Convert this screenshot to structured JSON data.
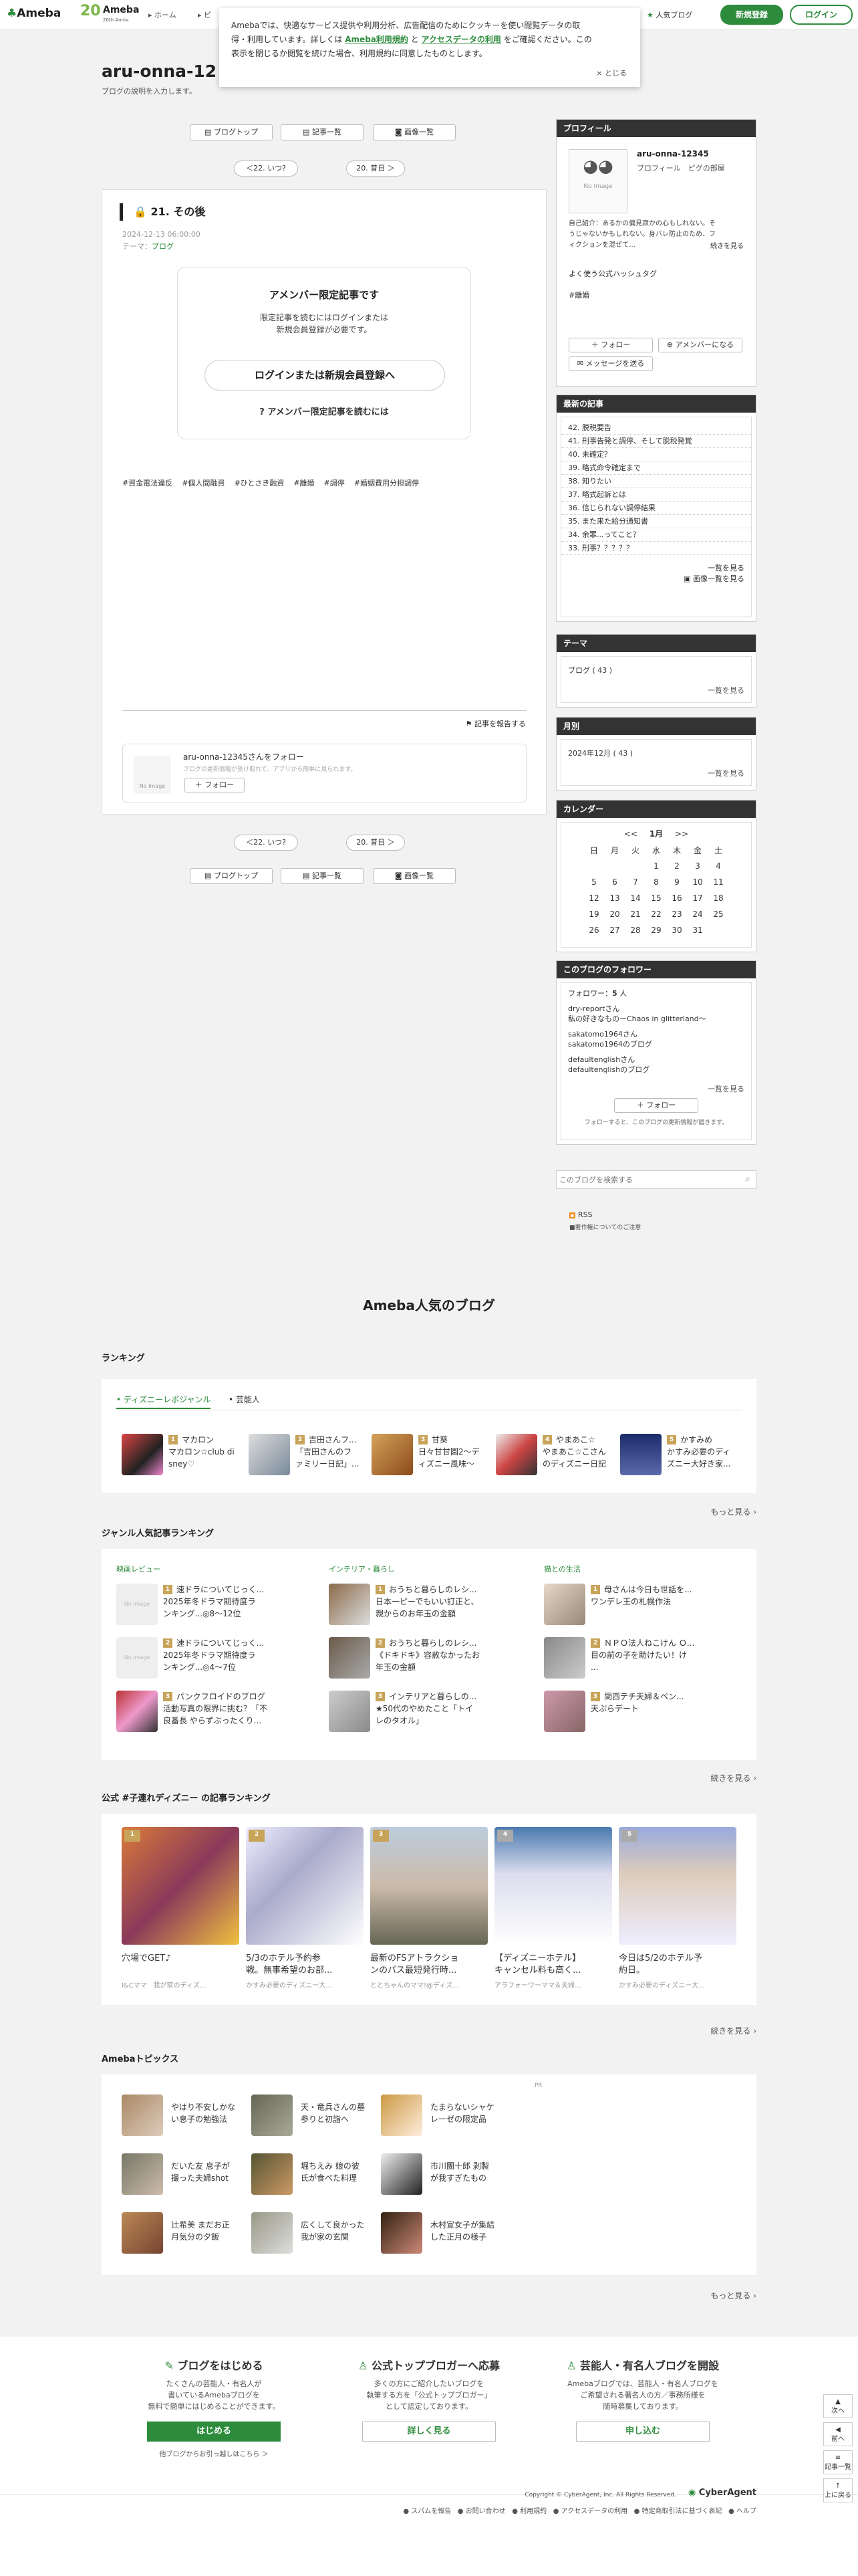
{
  "header": {
    "logo": "Ameba",
    "logo2": "Ameba",
    "logo2_sub": "20th Anniv.",
    "nav": [
      "ホーム",
      "ピ"
    ],
    "popular": "人気ブログ",
    "signup": "新規登録",
    "login": "ログイン"
  },
  "cookie": {
    "text1": "Amebaでは、快適なサービス提供や利用分析、広告配信のためにクッキーを使い閲覧データの取",
    "text2": "得・利用しています。詳しくは ",
    "terms": "Ameba利用規約",
    "mid": " と ",
    "access": "アクセスデータの利用",
    "text3": " をご確認ください。この",
    "text4": "表示を閉じるか閲覧を続けた場合、利用規約に同意したものとします。",
    "close": "× とじる"
  },
  "blog": {
    "title": "aru-onna-12",
    "desc": "ブログの説明を入力します。"
  },
  "nav_top": {
    "top": "ブログトップ",
    "list": "記事一覧",
    "images": "画像一覧",
    "prev": "＜22. いつ?",
    "next": "20. 昔日 ＞"
  },
  "article": {
    "title": "21. その後",
    "date": "2024-12-13 06:00:00",
    "theme": "テーマ：",
    "theme_link": "ブログ",
    "member_h": "アメンバー限定記事です",
    "member_p1": "限定記事を読むにはログインまたは",
    "member_p2": "新規会員登録が必要です。",
    "cta": "ログインまたは新規会員登録へ",
    "how": "アメンバー限定記事を読むには",
    "tags": [
      "#資金電法違反",
      "#個人間融資",
      "#ひとさき融資",
      "#離婚",
      "#調停",
      "#婚姻費用分担調停"
    ],
    "report": "記事を報告する",
    "follow_title": "aru-onna-12345さんをフォロー",
    "follow_desc": "ブログの更新情報が受け取れて、アプリから簡単に見られます。",
    "follow_btn": "フォロー"
  },
  "profile": {
    "title": "プロフィール",
    "name": "aru-onna-12345",
    "links": "プロフィール　ピグの部屋",
    "bio1": "自己紹介：あるかの偏見寂かの心もしれない。そ",
    "bio2": "うじゃないかもしれない。身バレ防止のため、フ",
    "bio3": "ィクションを混ぜて...",
    "bio_more": "続きを見る",
    "hashtag_h": "よく使う公式ハッシュタグ",
    "hashtag": "#離婚",
    "follow": "フォロー",
    "amember": "アメンバーになる",
    "message": "メッセージを送る",
    "noimage": "No Image"
  },
  "recent": {
    "title": "最新の記事",
    "items": [
      "42. 脱税要告",
      "41. 刑事告発と調停、そして脱税発覚",
      "40. 未確定？",
      "39. 略式命令確定まで",
      "38. 知りたい",
      "37. 略式起訴とは",
      "36. 信じられない調停結果",
      "35. また来た給分通知書",
      "34. 余罪...ってこと？",
      "33. 刑事？？？？？"
    ],
    "more": "一覧を見る",
    "img_more": "画像一覧を見る"
  },
  "theme": {
    "title": "テーマ",
    "item": "ブログ ( 43 )",
    "more": "一覧を見る"
  },
  "monthly": {
    "title": "月別",
    "item": "2024年12月 ( 43 )",
    "more": "一覧を見る"
  },
  "calendar": {
    "title": "カレンダー",
    "month": "1月",
    "prev": "<<",
    "next": ">>",
    "days": [
      "日",
      "月",
      "火",
      "水",
      "木",
      "金",
      "土"
    ],
    "weeks": [
      [
        "",
        "",
        "",
        "1",
        "2",
        "3",
        "4"
      ],
      [
        "5",
        "6",
        "7",
        "8",
        "9",
        "10",
        "11"
      ],
      [
        "12",
        "13",
        "14",
        "15",
        "16",
        "17",
        "18"
      ],
      [
        "19",
        "20",
        "21",
        "22",
        "23",
        "24",
        "25"
      ],
      [
        "26",
        "27",
        "28",
        "29",
        "30",
        "31",
        ""
      ]
    ]
  },
  "followers": {
    "title": "このブログのフォロワー",
    "count_label": "フォロワー：",
    "count": "5",
    "unit": " 人",
    "list": [
      "dry-reportさん",
      "私の好きなものーChaos in glitterland〜",
      "sakatomo1964さん",
      "sakatomo1964のブログ",
      "defaultenglishさん",
      "defaultenglishのブログ"
    ],
    "more": "一覧を見る",
    "btn": "フォロー",
    "note": "フォローすると、このブログの更新情報が届きます。"
  },
  "search": {
    "placeholder": "このブログを検索する"
  },
  "rss": {
    "label": "RSS",
    "note": "■著作権についてのご注意"
  },
  "popular": {
    "title": "Ameba人気のブログ",
    "ranking": "ランキング",
    "tabs": [
      "ディズニーレポジャンル",
      "芸能人"
    ],
    "rank_items": [
      {
        "t1": "マカロン",
        "t2": "マカロン☆club di",
        "t3": "sney♡"
      },
      {
        "t1": "吉田さんフ...",
        "t2": "「吉田さんのフ",
        "t3": "ァミリー日記」..."
      },
      {
        "t1": "甘葵",
        "t2": "日々甘甘園2〜デ",
        "t3": "ィズニー風味〜"
      },
      {
        "t1": "やまあこ☆",
        "t2": "やまあこ☆こさん",
        "t3": "のディズニー日記"
      },
      {
        "t1": "かすみめ",
        "t2": "かすみ必要のディ",
        "t3": "ズニー大好き家..."
      }
    ],
    "more": "もっと見る",
    "genre_title": "ジャンル人気記事ランキング",
    "genres": [
      {
        "name": "映画レビュー",
        "items": [
          {
            "a": "速ドラについてじっく...",
            "b": "2025年冬ドラマ期待度ラ",
            "c": "ンキング...◎8〜12位"
          },
          {
            "a": "速ドラについてじっく...",
            "b": "2025年冬ドラマ期待度ラ",
            "c": "ンキング...◎4〜7位"
          },
          {
            "a": "パンクフロイドのブログ",
            "b": "活動写真の限界に挑む？「不",
            "c": "良番長 やらずぶったくり..."
          }
        ]
      },
      {
        "name": "インテリア・暮らし",
        "items": [
          {
            "a": "おうちと暮らしのレシ...",
            "b": "日本一ピーでもいい訂正と、",
            "c": "親からのお年玉の金額"
          },
          {
            "a": "おうちと暮らしのレシ...",
            "b": "《ドキドキ》容赦なかったお",
            "c": "年玉の金額"
          },
          {
            "a": "インテリアと暮らしの...",
            "b": "★50代のやめたこと「トイ",
            "c": "レのタオル」"
          }
        ]
      },
      {
        "name": "猫との生活",
        "items": [
          {
            "a": "母さんは今日も世話を...",
            "b": "ワンデレ王の札幌作法",
            "c": ""
          },
          {
            "a": "ＮＰＯ法人ねこけん Ｏ...",
            "b": "目の前の子を助けたい！け",
            "c": "..."
          },
          {
            "a": "関西テチ天婦＆ペン...",
            "b": "天ぷらデート",
            "c": ""
          }
        ]
      }
    ],
    "genre_more": "続きを見る",
    "official_title": "公式 #子連れディズニー の記事ランキング",
    "official": [
      {
        "t": "穴場でGET♪",
        "s": "l&Cママ　我が家のディズ..."
      },
      {
        "t": "5/3のホテル予約参",
        "t2": "戦。無事希望のお部...",
        "s": "かすみ必要のディズニー大..."
      },
      {
        "t": "最新のFSアトラクショ",
        "t2": "ンのパス最短発行時...",
        "s": "ととちゃんのママ!@ディズ..."
      },
      {
        "t": "【ディズニーホテル】",
        "t2": "キャンセル料も高く...",
        "s": "アラフォーワーママ＆夫婦..."
      },
      {
        "t": "今日は5/2のホテル予",
        "t2": "約日。",
        "s": "かすみ必要のディズニー大..."
      }
    ],
    "official_more": "続きを見る",
    "topics_title": "Amebaトピックス",
    "topics": [
      {
        "a": "やはり不安しかな",
        "b": "い息子の勉強法"
      },
      {
        "a": "天・竜兵さんの墓",
        "b": "参りと初詣へ"
      },
      {
        "a": "たまらないシャケ",
        "b": "レーゼの限定品"
      },
      {
        "a": "だいた友 息子が",
        "b": "撮った夫婦shot"
      },
      {
        "a": "堀ちえみ 娘の彼",
        "b": "氏が食べた料理"
      },
      {
        "a": "市川團十郎 剥製",
        "b": "が我すぎたもの"
      },
      {
        "a": "辻希美 まだお正",
        "b": "月気分の夕飯"
      },
      {
        "a": "広くして良かった",
        "b": "我が家の玄関"
      },
      {
        "a": "木村宣女子が集結",
        "b": "した正月の様子"
      }
    ],
    "pr": "PR",
    "topics_more": "もっと見る"
  },
  "footer": {
    "cols": [
      {
        "h": "ブログをはじめる",
        "p1": "たくさんの芸能人・有名人が",
        "p2": "書いているAmebaブログを",
        "p3": "無料で簡単にはじめることができます。",
        "btn": "はじめる",
        "link": "他ブログからお引っ越しはこちら ＞"
      },
      {
        "h": "公式トップブロガーへ応募",
        "p1": "多くの方にご紹介したいブログを",
        "p2": "執筆する方を「公式トップブロガー」",
        "p3": "として認定しております。",
        "btn": "詳しく見る"
      },
      {
        "h": "芸能人・有名人ブログを開設",
        "p1": "Amebaブログでは、芸能人・有名人ブログを",
        "p2": "ご希望される著名人の方／事務所様を",
        "p3": "随時募集しております。",
        "btn": "申し込む"
      }
    ],
    "copyright": "Copyright © CyberAgent, Inc. All Rights Reserved.",
    "ca": "CyberAgent",
    "links": [
      "スパムを報告",
      "お問い合わせ",
      "利用規約",
      "アクセスデータの利用",
      "特定商取引法に基づく表記",
      "ヘルプ"
    ],
    "side": [
      "次へ",
      "前へ",
      "記事一覧",
      "上に戻る"
    ]
  }
}
